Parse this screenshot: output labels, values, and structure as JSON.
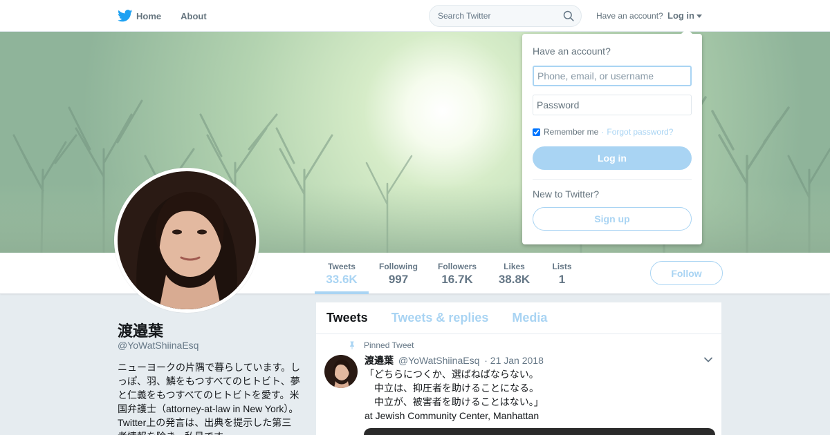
{
  "nav": {
    "home_label": "Home",
    "about_label": "About",
    "search_placeholder": "Search Twitter",
    "have_account": "Have an account?",
    "login_label": "Log in"
  },
  "profile": {
    "name": "渡邉葉",
    "handle": "@YoWatShiinaEsq",
    "bio": "ニューヨークの片隅で暮らしています。しっぽ、羽、鱗をもつすべてのヒトビト、夢と仁義をもつすべてのヒトビトを愛す。米国弁護士（attorney-at-law in New York）。 Twitter上の発言は、出典を提示した第三者情報を除き、私見です。"
  },
  "stats": [
    {
      "label": "Tweets",
      "value": "33.6K"
    },
    {
      "label": "Following",
      "value": "997"
    },
    {
      "label": "Followers",
      "value": "16.7K"
    },
    {
      "label": "Likes",
      "value": "38.8K"
    },
    {
      "label": "Lists",
      "value": "1"
    }
  ],
  "follow_label": "Follow",
  "timeline": {
    "tabs": [
      "Tweets",
      "Tweets & replies",
      "Media"
    ],
    "tweet": {
      "pinned_label": "Pinned Tweet",
      "name": "渡邉葉",
      "handle": "@YoWatShiinaEsq",
      "date": "· 21 Jan 2018",
      "text": "「どちらにつくか、選ばねばならない。\n　中立は、抑圧者を助けることになる。\n　中立が、被害者を助けることはない。」\nat Jewish Community Center, Manhattan"
    }
  },
  "login_dropdown": {
    "title": "Have an account?",
    "username_placeholder": "Phone, email, or username",
    "password_placeholder": "Password",
    "remember_label": "Remember me",
    "separator": "·",
    "forgot_label": "Forgot password?",
    "login_button": "Log in",
    "new_label": "New to Twitter?",
    "signup_button": "Sign up"
  },
  "colors": {
    "accent_light": "#a9d4f3",
    "twitter_blue": "#1da1f2",
    "muted_text": "#657786"
  }
}
